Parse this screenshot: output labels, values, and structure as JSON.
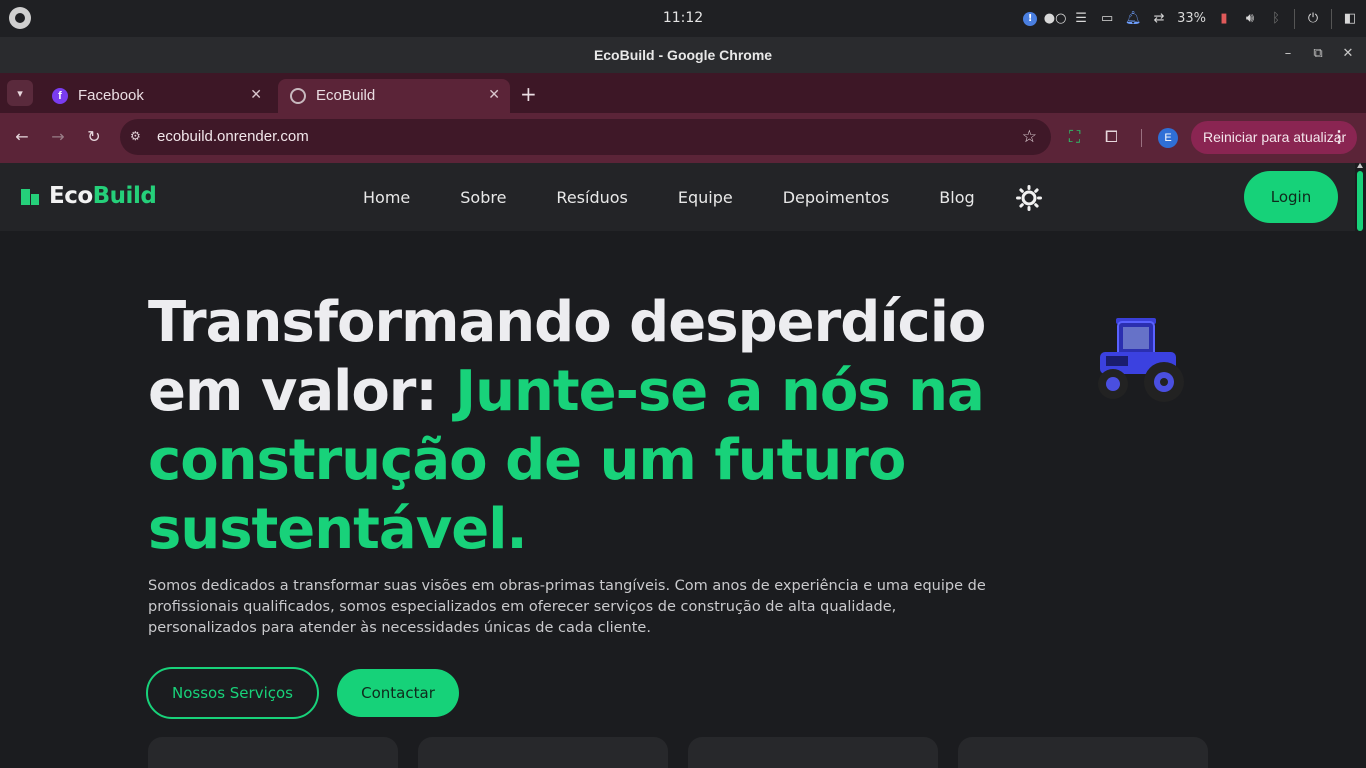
{
  "os": {
    "clock": "11:12",
    "battery": "33%",
    "icons": [
      "ubuntu-logo-icon",
      "alert-icon",
      "toggle-dots-icon",
      "menu-icon",
      "folder-icon",
      "bell-icon",
      "sync-icon",
      "battery-icon",
      "volume-icon",
      "bluetooth-icon",
      "power-icon",
      "panel-icon"
    ]
  },
  "window": {
    "title": "EcoBuild - Google Chrome"
  },
  "tabs": [
    {
      "label": "Facebook",
      "icon": "facebook-icon",
      "active": false
    },
    {
      "label": "EcoBuild",
      "icon": "globe-icon",
      "active": true
    }
  ],
  "address_bar": {
    "url": "ecobuild.onrender.com",
    "profile_initial": "E",
    "update_label": "Reiniciar para atualizar"
  },
  "site": {
    "brand": {
      "part1": "Eco",
      "part2": "Build"
    },
    "nav": [
      "Home",
      "Sobre",
      "Resíduos",
      "Equipe",
      "Depoimentos",
      "Blog"
    ],
    "login": "Login",
    "hero": {
      "title_plain": "Transformando desperdício em valor: ",
      "title_accent": "Junte-se a nós na construção de um futuro sustentável.",
      "description": "Somos dedicados a transformar suas visões em obras-primas tangíveis. Com anos de experiência e uma equipe de profissionais qualificados, somos especializados em oferecer serviços de construção de alta qualidade, personalizados para atender às necessidades únicas de cada cliente.",
      "btn_services": "Nossos Serviços",
      "btn_contact": "Contactar"
    }
  },
  "colors": {
    "accent": "#18d27a",
    "chrome_tab_strip": "#3d1726",
    "chrome_toolbar": "#5b2438",
    "page_bg": "#1b1c1f"
  }
}
